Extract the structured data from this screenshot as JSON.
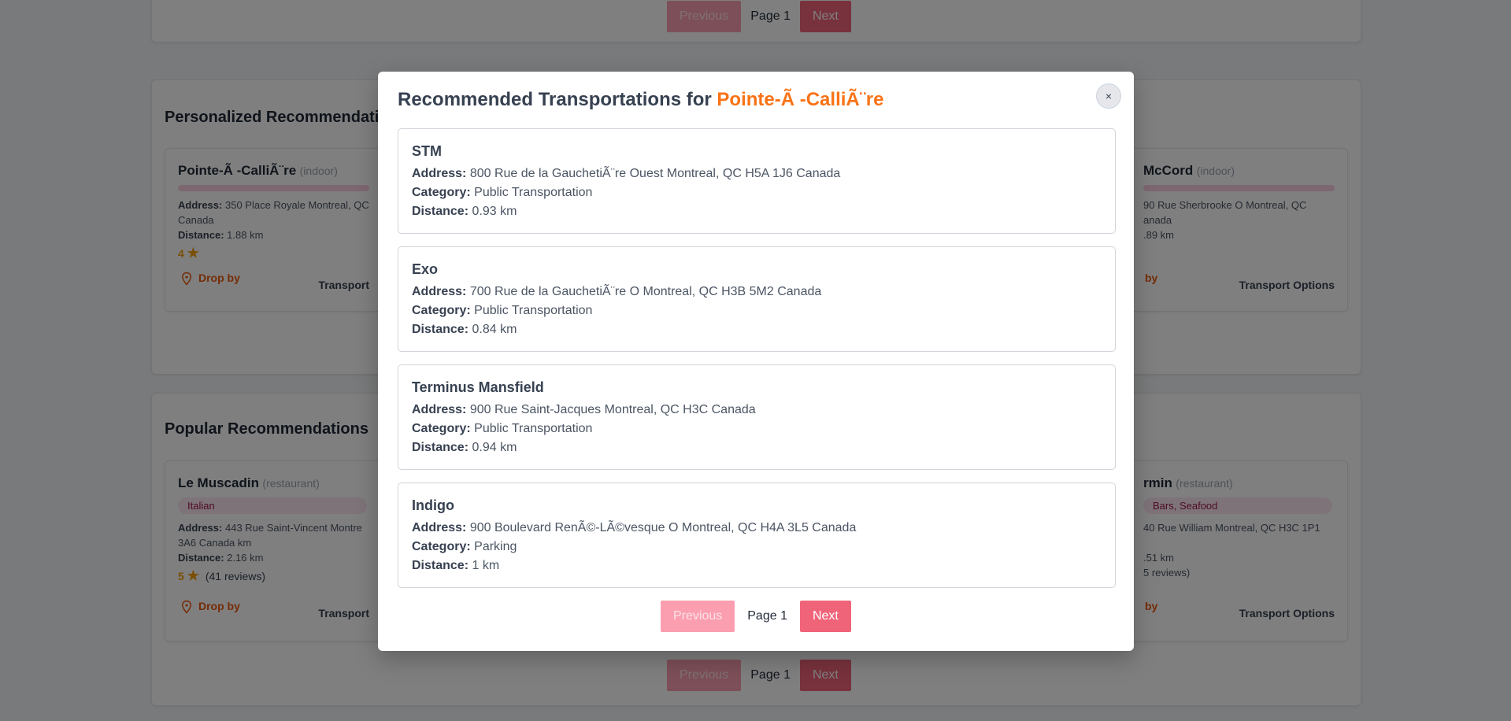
{
  "pagination": {
    "previous": "Previous",
    "page": "Page 1",
    "next": "Next"
  },
  "sections": {
    "personalized": {
      "title": "Personalized Recommendations",
      "left_card": {
        "name": "Pointe-Ã -CalliÃ¨re",
        "type": "(indoor)",
        "address_label": "Address:",
        "address": "350 Place Royale Montreal, QC",
        "address_cont": "Canada",
        "distance_label": "Distance:",
        "distance": "1.88 km",
        "rating": "4",
        "drop_by": "Drop by",
        "transport": "Transport"
      },
      "right_card": {
        "name": "McCord",
        "type": "(indoor)",
        "address": "90 Rue Sherbrooke O Montreal, QC",
        "address_cont": "anada",
        "distance": ".89 km",
        "drop_by": "by",
        "transport": "Transport Options"
      }
    },
    "popular": {
      "title": "Popular Recommendations",
      "left_card": {
        "name": "Le Muscadin",
        "type": "(restaurant)",
        "tag": "Italian",
        "address_label": "Address:",
        "address": "443 Rue Saint-Vincent Montre",
        "address_cont": "3A6 Canada km",
        "distance_label": "Distance:",
        "distance": "2.16 km",
        "rating": "5",
        "reviews": "(41 reviews)",
        "drop_by": "Drop by",
        "transport": "Transport"
      },
      "right_card": {
        "name": "rmin",
        "type": "(restaurant)",
        "tag": "Bars, Seafood",
        "address": "40 Rue William Montreal, QC H3C 1P1",
        "distance": ".51 km",
        "reviews": "5 reviews)",
        "drop_by": "by",
        "transport": "Transport Options"
      }
    }
  },
  "modal": {
    "title_prefix": "Recommended Transportations for",
    "place": "Pointe-Ã -CalliÃ¨re",
    "close": "×",
    "labels": {
      "address": "Address:",
      "category": "Category:",
      "distance": "Distance:"
    },
    "items": [
      {
        "name": "STM",
        "address": "800 Rue de la GauchetiÃ¨re Ouest Montreal, QC H5A 1J6 Canada",
        "category": "Public Transportation",
        "distance": "0.93 km"
      },
      {
        "name": "Exo",
        "address": "700 Rue de la GauchetiÃ¨re O Montreal, QC H3B 5M2 Canada",
        "category": "Public Transportation",
        "distance": "0.84 km"
      },
      {
        "name": "Terminus Mansfield",
        "address": "900 Rue Saint-Jacques Montreal, QC H3C Canada",
        "category": "Public Transportation",
        "distance": "0.94 km"
      },
      {
        "name": "Indigo",
        "address": "900 Boulevard RenÃ©-LÃ©vesque O Montreal, QC H4A 3L5 Canada",
        "category": "Parking",
        "distance": "1 km"
      }
    ],
    "pagination": {
      "previous": "Previous",
      "page": "Page 1",
      "next": "Next"
    }
  },
  "colors": {
    "accent_orange": "#f97316",
    "pink_button": "#f0647a",
    "pink_disabled": "#fb9fb0"
  },
  "icons": {
    "rating": "star-icon",
    "drop_by": "map-pin-heart-icon",
    "close": "close-icon"
  }
}
